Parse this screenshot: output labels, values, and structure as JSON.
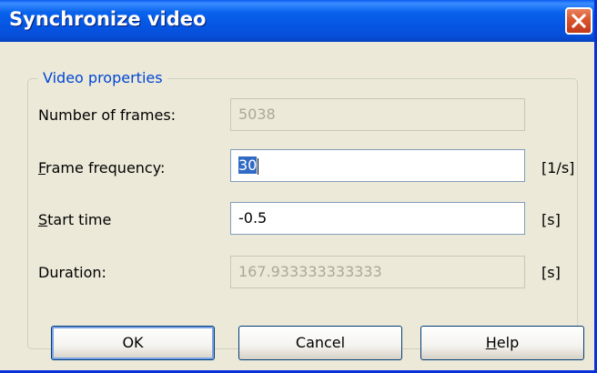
{
  "window": {
    "title": "Synchronize video"
  },
  "group": {
    "title": "Video properties"
  },
  "fields": {
    "frames": {
      "label": "Number of frames:",
      "value": "5038"
    },
    "frequency": {
      "label_key": "F",
      "label_rest": "rame frequency:",
      "value": "30",
      "unit": "[1/s]"
    },
    "start": {
      "label_key": "S",
      "label_rest": "tart time",
      "value": "-0.5",
      "unit": "[s]"
    },
    "duration": {
      "label": "Duration:",
      "value": "167.933333333333",
      "unit": "[s]"
    }
  },
  "buttons": {
    "ok": "OK",
    "cancel": "Cancel",
    "help_key": "H",
    "help_rest": "elp"
  },
  "colors": {
    "title_bar": "#0555E3",
    "dialog_bg": "#ECE9D8",
    "group_title": "#0046D5",
    "close_button": "#D9552C",
    "selection": "#316AC5"
  },
  "icons": {
    "close": "close-icon"
  }
}
